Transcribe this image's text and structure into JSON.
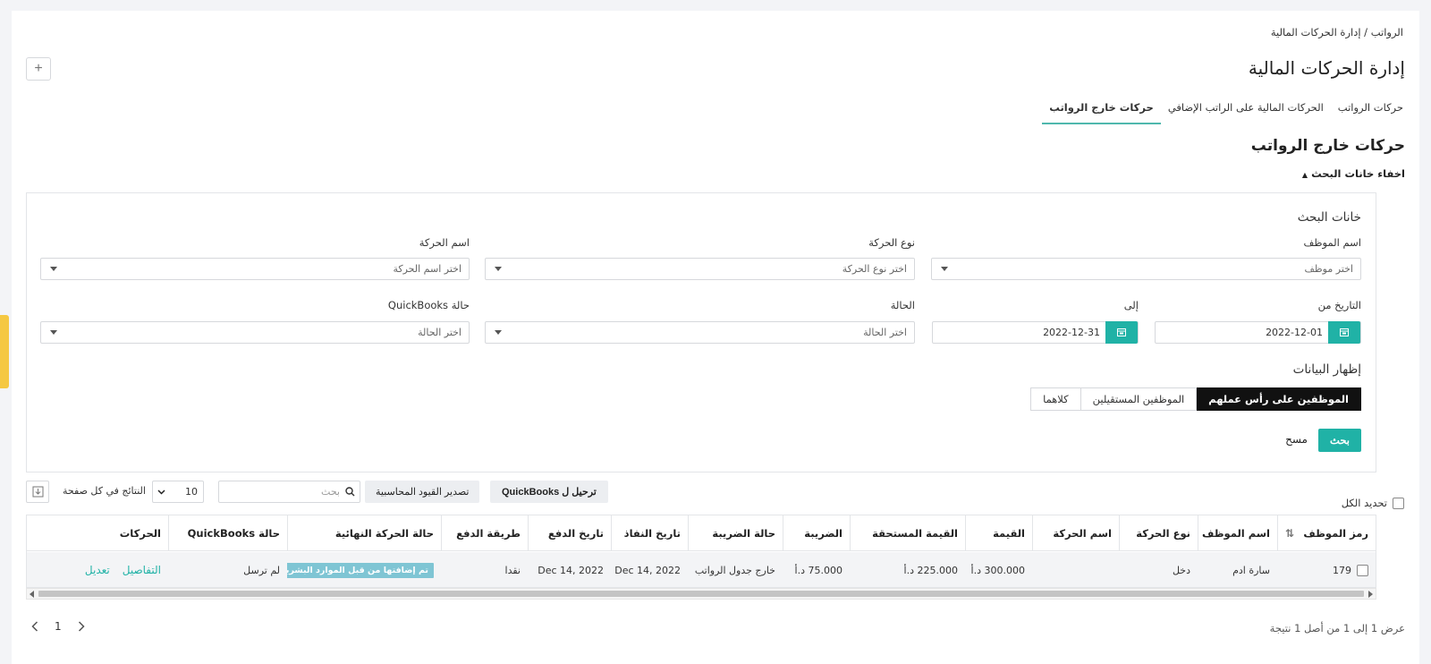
{
  "breadcrumb": "الرواتب / إدارة الحركات المالية",
  "page_title": "إدارة الحركات المالية",
  "add_button_label": "+",
  "tabs": [
    {
      "label": "حركات الرواتب",
      "active": false
    },
    {
      "label": "الحركات المالية على الراتب الإضافي",
      "active": false
    },
    {
      "label": "حركات خارج الرواتب",
      "active": true
    }
  ],
  "section_title": "حركات خارج الرواتب",
  "toggle_search_label": "اخفاء خانات البحث",
  "search": {
    "title": "خانات البحث",
    "employee_label": "اسم الموظف",
    "employee_placeholder": "اختر موظف",
    "movement_type_label": "نوع الحركة",
    "movement_type_placeholder": "اختر نوع الحركة",
    "movement_name_label": "اسم الحركة",
    "movement_name_placeholder": "اختر اسم الحركة",
    "date_from_label": "التاريخ من",
    "date_from_value": "2022-12-01",
    "date_to_label": "إلى",
    "date_to_value": "2022-12-31",
    "status_label": "الحالة",
    "status_placeholder": "اختر الحالة",
    "qb_status_label": "حالة QuickBooks",
    "qb_status_placeholder": "اختر الحالة",
    "show_data_label": "إظهار البيانات",
    "show_options": [
      {
        "label": "الموظفين على رأس عملهم",
        "active": true
      },
      {
        "label": "الموظفين المستقيلين",
        "active": false
      },
      {
        "label": "كلاهما",
        "active": false
      }
    ],
    "search_button": "بحث",
    "clear_button": "مسح"
  },
  "toolbar": {
    "select_all_label": "تحديد الكل",
    "quickbooks_button": "ترحيل ل QuickBooks",
    "export_button": "تصدير القيود المحاسبية",
    "search_placeholder": "بحث",
    "per_page_value": "10",
    "per_page_label": "النتائج في كل صفحة"
  },
  "table": {
    "headers": [
      "رمز الموظف",
      "اسم الموظف",
      "نوع الحركة",
      "اسم الحركة",
      "القيمة",
      "القيمة المستحقة",
      "الضريبة",
      "حالة الضريبة",
      "تاريخ النفاذ",
      "تاريخ الدفع",
      "طريقة الدفع",
      "حالة الحركة النهائية",
      "حالة QuickBooks",
      "الحركات"
    ],
    "rows": [
      {
        "code": "179",
        "employee": "سارة ادم",
        "type": "دخل",
        "name": "",
        "value": "300.000 د.أ",
        "due": "225.000 د.أ",
        "tax": "75.000 د.أ",
        "tax_status": "خارج جدول الرواتب",
        "effective_date": "Dec 14, 2022",
        "payment_date": "Dec 14, 2022",
        "payment_method": "نقدا",
        "final_status": "تم إضافتها من قبل الموارد البشرية",
        "qb_status": "لم ترسل",
        "details_link": "التفاصيل",
        "edit_link": "تعديل"
      }
    ]
  },
  "pagination": {
    "summary": "عرض 1 إلى 1 من أصل 1 نتيجة",
    "current_page": "1"
  },
  "colors": {
    "accent": "#20b2a6",
    "badge": "#7fc5d4",
    "side_tab": "#f5c842"
  }
}
